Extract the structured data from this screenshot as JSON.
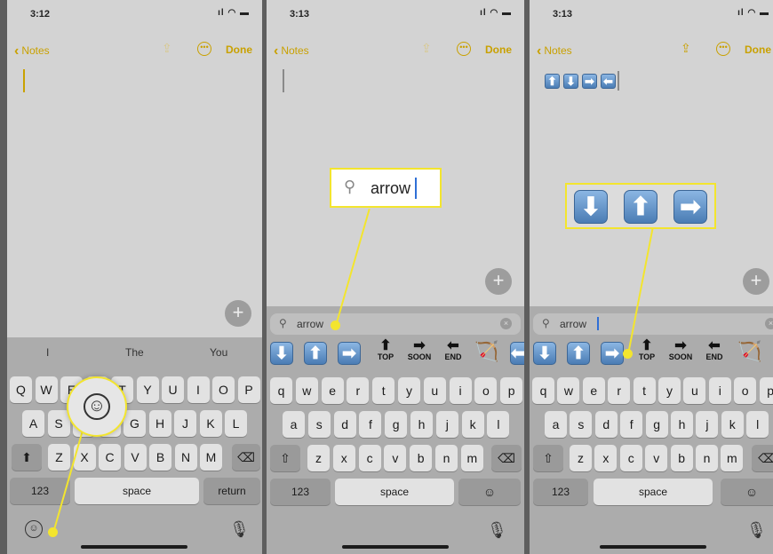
{
  "panels": [
    {
      "time": "3:12",
      "back_label": "Notes",
      "done_label": "Done",
      "suggestions": [
        "I",
        "The",
        "You"
      ],
      "rows": [
        [
          "Q",
          "W",
          "E",
          "R",
          "T",
          "Y",
          "U",
          "I",
          "O",
          "P"
        ],
        [
          "A",
          "S",
          "D",
          "F",
          "G",
          "H",
          "J",
          "K",
          "L"
        ],
        [
          "Z",
          "X",
          "C",
          "V",
          "B",
          "N",
          "M"
        ]
      ],
      "num_label": "123",
      "space_label": "space",
      "return_label": "return"
    },
    {
      "time": "3:13",
      "back_label": "Notes",
      "done_label": "Done",
      "search_query": "arrow",
      "callout_text": "arrow",
      "word_emojis": [
        "TOP",
        "SOON",
        "END"
      ],
      "rows": [
        [
          "q",
          "w",
          "e",
          "r",
          "t",
          "y",
          "u",
          "i",
          "o",
          "p"
        ],
        [
          "a",
          "s",
          "d",
          "f",
          "g",
          "h",
          "j",
          "k",
          "l"
        ],
        [
          "z",
          "x",
          "c",
          "v",
          "b",
          "n",
          "m"
        ]
      ],
      "num_label": "123",
      "space_label": "space"
    },
    {
      "time": "3:13",
      "back_label": "Notes",
      "done_label": "Done",
      "search_query": "arrow",
      "word_emojis": [
        "TOP",
        "SOON",
        "END"
      ],
      "rows": [
        [
          "q",
          "w",
          "e",
          "r",
          "t",
          "y",
          "u",
          "i",
          "o",
          "p"
        ],
        [
          "a",
          "s",
          "d",
          "f",
          "g",
          "h",
          "j",
          "k",
          "l"
        ],
        [
          "z",
          "x",
          "c",
          "v",
          "b",
          "n",
          "m"
        ]
      ],
      "num_label": "123",
      "space_label": "space"
    }
  ],
  "colors": {
    "accent": "#c9a100",
    "callout": "#f3e52e",
    "emoji_blue": "#4a7cb4"
  },
  "icons": [
    "signal-wifi-battery-icon",
    "share-icon",
    "more-icon",
    "plus-icon",
    "emoji-icon",
    "microphone-icon",
    "search-icon",
    "clear-icon",
    "shift-icon",
    "delete-icon"
  ]
}
